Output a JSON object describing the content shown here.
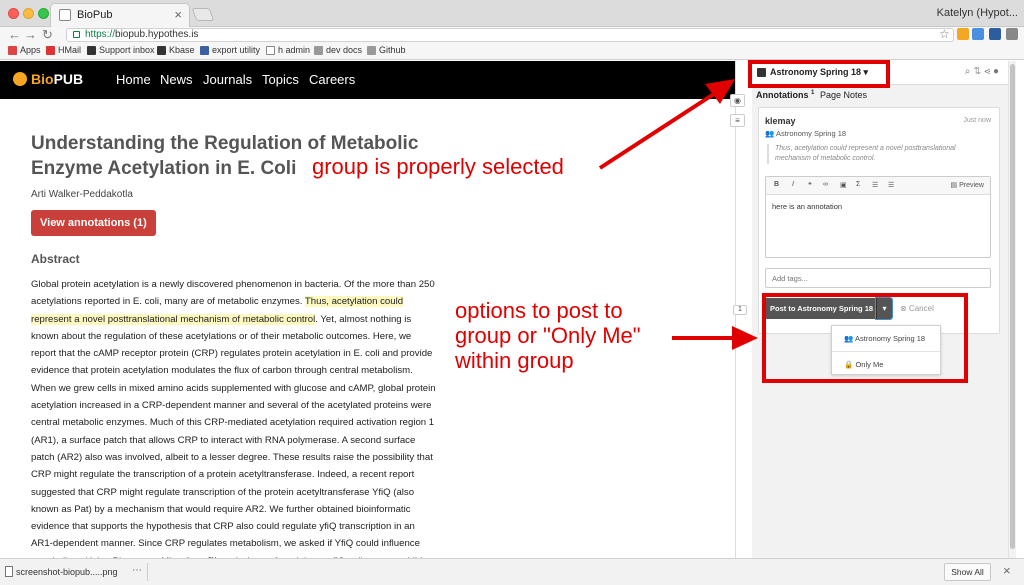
{
  "browser": {
    "tab_title": "BioPub",
    "profile": "Katelyn (Hypot...",
    "url_scheme": "https://",
    "url_host": "biopub.hypothes.is",
    "bookmarks": [
      "Apps",
      "HMail",
      "Support inbox",
      "Kbase",
      "export utility",
      "h admin",
      "dev docs",
      "Github"
    ]
  },
  "site": {
    "logo_bio": "Bio",
    "logo_pub": "PUB",
    "nav": [
      "Home",
      "News",
      "Journals",
      "Topics",
      "Careers"
    ]
  },
  "article": {
    "title": "Understanding the Regulation of Metabolic Enzyme Acetylation in E. Coli",
    "author": "Arti Walker-Peddakotla",
    "view_button": "View annotations (1)",
    "abstract_heading": "Abstract",
    "abstract_before": "Global protein acetylation is a newly discovered phenomenon in bacteria. Of the more than 250 acetylations reported in E. coli, many are of metabolic enzymes. ",
    "abstract_highlight": "Thus, acetylation could represent a novel posttranslational mechanism of metabolic control",
    "abstract_after": ". Yet, almost nothing is known about the regulation of these acetylations or of their metabolic outcomes. Here, we report that the cAMP receptor protein (CRP) regulates protein acetylation in E. coli and provide evidence that protein acetylation modulates the flux of carbon through central metabolism. When we grew cells in mixed amino acids supplemented with glucose and cAMP, global protein acetylation increased in a CRP-dependent manner and several of the acetylated proteins were central metabolic enzymes. Much of this CRP-mediated acetylation required activation region 1 (AR1), a surface patch that allows CRP to interact with RNA polymerase. A second surface patch (AR2) also was involved, albeit to a lesser degree. These results raise the possibility that CRP might regulate the transcription of a protein acetyltransferase. Indeed, a recent report suggested that CRP might regulate transcription of the protein acetyltransferase YfiQ (also known as Pat) by a mechanism that would require AR2. We further obtained bioinformatic evidence that supports the hypothesis that CRP also could regulate yfiQ transcription in an AR1-dependent manner. Since CRP regulates metabolism, we asked if YfiQ could influence metabolism. Using Phenotype MicroArray™ analysis, we found that a yfiQ null mutant exhibits a distinctive defect during growth"
  },
  "sidebar": {
    "group": "Astronomy Spring 18",
    "tab_annotations": "Annotations",
    "tab_annotations_count": "1",
    "tab_page_notes": "Page Notes",
    "page_count": "1",
    "card": {
      "user": "klemay",
      "time": "Just now",
      "group": "Astronomy Spring 18",
      "quote": "Thus, acetylation could represent a novel posttranslational mechanism of metabolic control.",
      "preview": "Preview",
      "text": "here is an annotation",
      "tags_placeholder": "Add tags..."
    },
    "post_button": "Post to Astronomy Spring 18",
    "cancel": "Cancel",
    "dropdown": [
      "Astronomy Spring 18",
      "Only Me"
    ]
  },
  "annotations": {
    "group_note": "group is properly selected",
    "options_note_1": "options to post to",
    "options_note_2": "group or \"Only Me\"",
    "options_note_3": "within group"
  },
  "download": {
    "file": "screenshot-biopub.....png",
    "more": "⋯",
    "show_all": "Show All"
  },
  "colors": {
    "annotation_red": "#e00000",
    "view_button": "#c9403a",
    "highlight": "#fcf8c0",
    "logo_accent": "#f5a623"
  }
}
